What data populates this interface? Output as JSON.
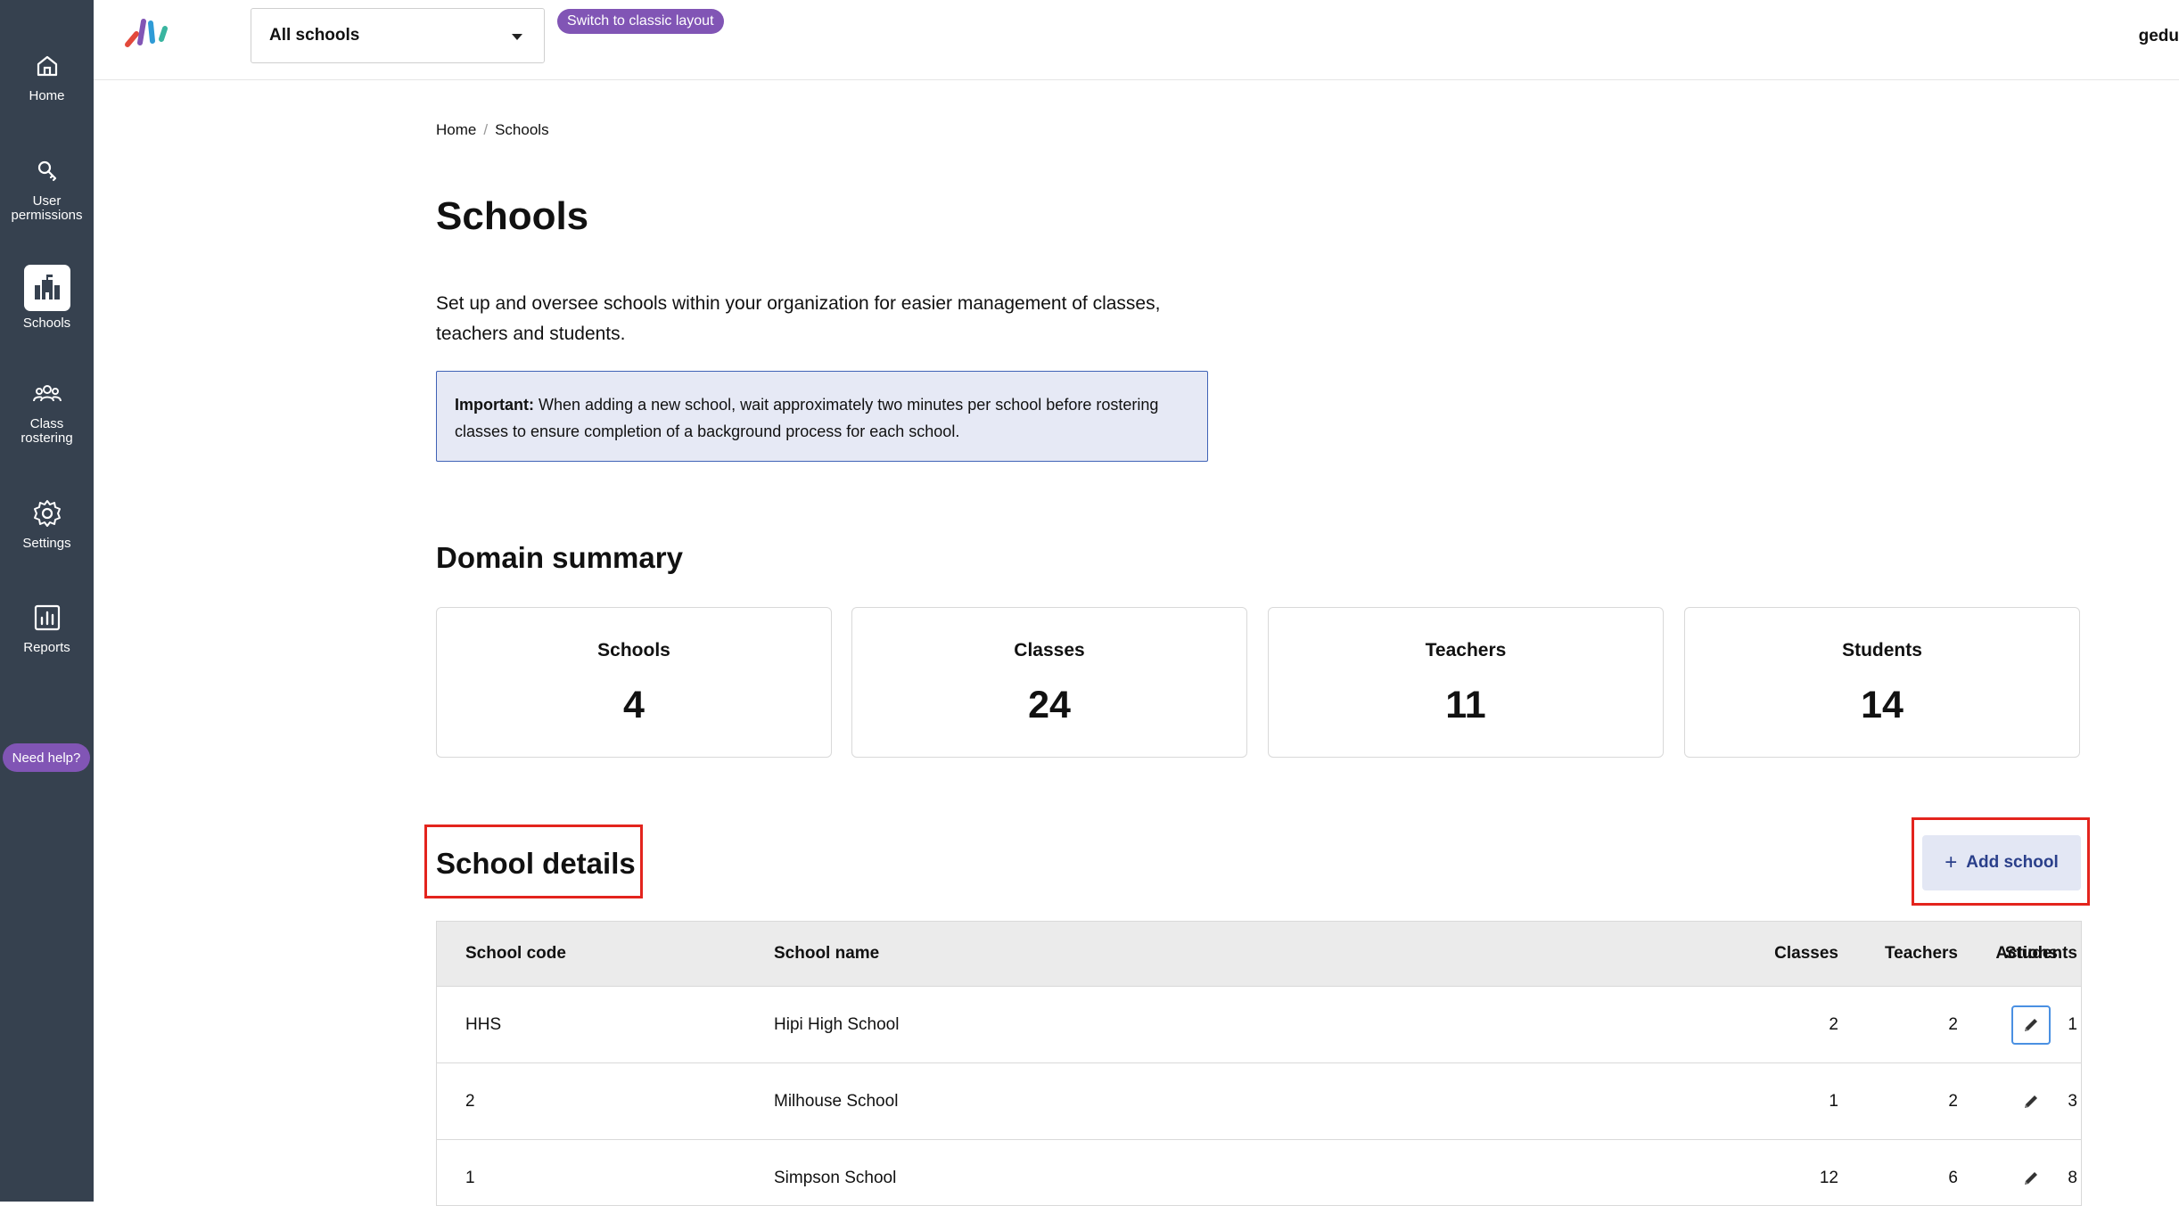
{
  "sidebar": {
    "items": [
      {
        "label": "Home",
        "icon": "home-icon"
      },
      {
        "label": "User permissions",
        "icon": "key-icon"
      },
      {
        "label": "Schools",
        "icon": "schools-icon",
        "active": true
      },
      {
        "label": "Class rostering",
        "icon": "people-icon"
      },
      {
        "label": "Settings",
        "icon": "gear-icon"
      },
      {
        "label": "Reports",
        "icon": "chart-icon"
      }
    ],
    "help_label": "Need help?"
  },
  "header": {
    "school_select_value": "All schools",
    "classic_layout_label": "Switch to classic layout",
    "user_name": "gedu"
  },
  "breadcrumb": {
    "home": "Home",
    "current": "Schools"
  },
  "page": {
    "title": "Schools",
    "intro": "Set up and oversee schools within your organization for easier management of classes, teachers and students.",
    "notice_strong": "Important:",
    "notice_text": " When adding a new school, wait approximately two minutes per school before rostering classes to ensure completion of a background process for each school."
  },
  "summary": {
    "title": "Domain summary",
    "cards": [
      {
        "label": "Schools",
        "value": "4"
      },
      {
        "label": "Classes",
        "value": "24"
      },
      {
        "label": "Teachers",
        "value": "11"
      },
      {
        "label": "Students",
        "value": "14"
      }
    ]
  },
  "details": {
    "title": "School details",
    "add_label": "Add school",
    "columns": {
      "code": "School code",
      "name": "School name",
      "classes": "Classes",
      "teachers": "Teachers",
      "students": "Students",
      "actions": "Actions"
    },
    "rows": [
      {
        "code": "HHS",
        "name": "Hipi High School",
        "classes": "2",
        "teachers": "2",
        "students": "1"
      },
      {
        "code": "2",
        "name": "Milhouse School",
        "classes": "1",
        "teachers": "2",
        "students": "3"
      },
      {
        "code": "1",
        "name": "Simpson School",
        "classes": "12",
        "teachers": "6",
        "students": "8"
      }
    ]
  },
  "colors": {
    "sidebar_bg": "#36414f",
    "accent_purple": "#8155b5",
    "highlight_red": "#e3241d",
    "notice_bg": "#e6e9f5",
    "notice_border": "#3f62b6"
  }
}
